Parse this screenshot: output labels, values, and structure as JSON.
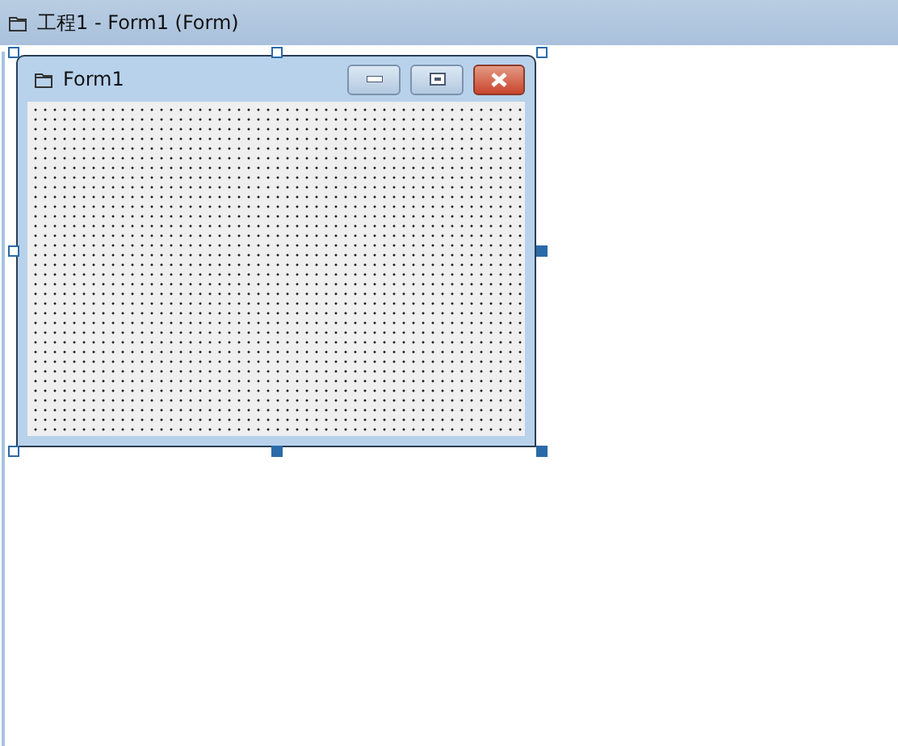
{
  "window": {
    "title": "工程1 - Form1 (Form)"
  },
  "form": {
    "title": "Form1",
    "selected": true
  }
}
